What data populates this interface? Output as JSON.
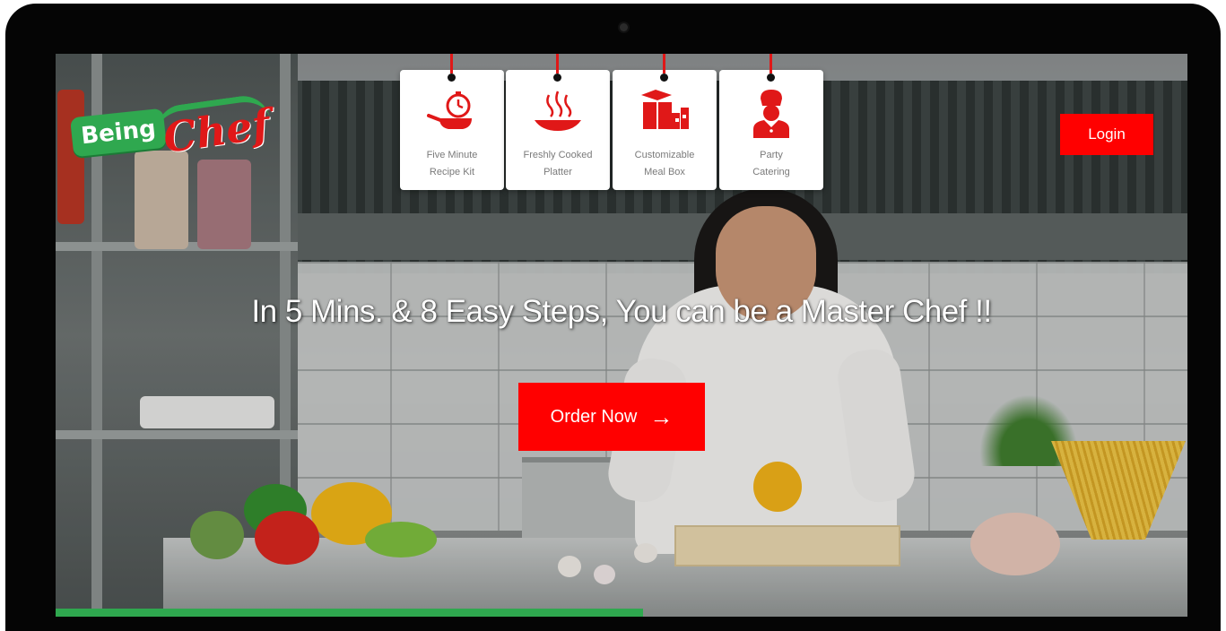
{
  "brand": {
    "name_part1": "Being",
    "name_part2": "Chef",
    "green": "#2fa84f",
    "red": "#e01818"
  },
  "nav": {
    "login_label": "Login"
  },
  "services": [
    {
      "label_line1": "Five Minute",
      "label_line2": "Recipe Kit",
      "icon": "frying-pan-timer-icon"
    },
    {
      "label_line1": "Freshly Cooked",
      "label_line2": "Platter",
      "icon": "steaming-platter-icon"
    },
    {
      "label_line1": "Customizable",
      "label_line2": "Meal Box",
      "icon": "meal-box-icon"
    },
    {
      "label_line1": "Party",
      "label_line2": "Catering",
      "icon": "chef-icon"
    }
  ],
  "hero": {
    "headline": "In 5 Mins. & 8 Easy Steps, You can be a Master Chef !!",
    "cta_label": "Order Now",
    "cta_icon": "arrow-right-icon",
    "accent": "#ff0000"
  }
}
